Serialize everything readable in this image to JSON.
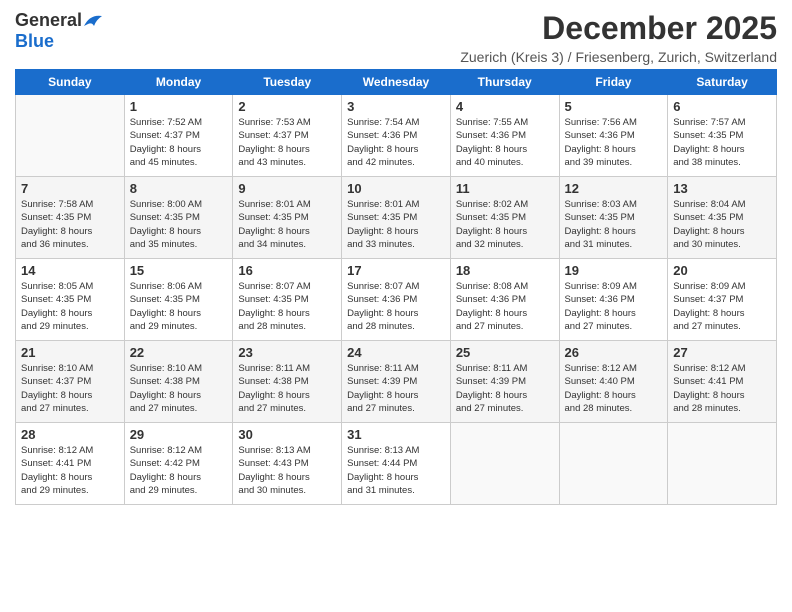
{
  "logo": {
    "general": "General",
    "blue": "Blue"
  },
  "header": {
    "title": "December 2025",
    "subtitle": "Zuerich (Kreis 3) / Friesenberg, Zurich, Switzerland"
  },
  "calendar": {
    "days": [
      "Sunday",
      "Monday",
      "Tuesday",
      "Wednesday",
      "Thursday",
      "Friday",
      "Saturday"
    ],
    "weeks": [
      [
        {
          "day": "",
          "info": ""
        },
        {
          "day": "1",
          "info": "Sunrise: 7:52 AM\nSunset: 4:37 PM\nDaylight: 8 hours\nand 45 minutes."
        },
        {
          "day": "2",
          "info": "Sunrise: 7:53 AM\nSunset: 4:37 PM\nDaylight: 8 hours\nand 43 minutes."
        },
        {
          "day": "3",
          "info": "Sunrise: 7:54 AM\nSunset: 4:36 PM\nDaylight: 8 hours\nand 42 minutes."
        },
        {
          "day": "4",
          "info": "Sunrise: 7:55 AM\nSunset: 4:36 PM\nDaylight: 8 hours\nand 40 minutes."
        },
        {
          "day": "5",
          "info": "Sunrise: 7:56 AM\nSunset: 4:36 PM\nDaylight: 8 hours\nand 39 minutes."
        },
        {
          "day": "6",
          "info": "Sunrise: 7:57 AM\nSunset: 4:35 PM\nDaylight: 8 hours\nand 38 minutes."
        }
      ],
      [
        {
          "day": "7",
          "info": "Sunrise: 7:58 AM\nSunset: 4:35 PM\nDaylight: 8 hours\nand 36 minutes."
        },
        {
          "day": "8",
          "info": "Sunrise: 8:00 AM\nSunset: 4:35 PM\nDaylight: 8 hours\nand 35 minutes."
        },
        {
          "day": "9",
          "info": "Sunrise: 8:01 AM\nSunset: 4:35 PM\nDaylight: 8 hours\nand 34 minutes."
        },
        {
          "day": "10",
          "info": "Sunrise: 8:01 AM\nSunset: 4:35 PM\nDaylight: 8 hours\nand 33 minutes."
        },
        {
          "day": "11",
          "info": "Sunrise: 8:02 AM\nSunset: 4:35 PM\nDaylight: 8 hours\nand 32 minutes."
        },
        {
          "day": "12",
          "info": "Sunrise: 8:03 AM\nSunset: 4:35 PM\nDaylight: 8 hours\nand 31 minutes."
        },
        {
          "day": "13",
          "info": "Sunrise: 8:04 AM\nSunset: 4:35 PM\nDaylight: 8 hours\nand 30 minutes."
        }
      ],
      [
        {
          "day": "14",
          "info": "Sunrise: 8:05 AM\nSunset: 4:35 PM\nDaylight: 8 hours\nand 29 minutes."
        },
        {
          "day": "15",
          "info": "Sunrise: 8:06 AM\nSunset: 4:35 PM\nDaylight: 8 hours\nand 29 minutes."
        },
        {
          "day": "16",
          "info": "Sunrise: 8:07 AM\nSunset: 4:35 PM\nDaylight: 8 hours\nand 28 minutes."
        },
        {
          "day": "17",
          "info": "Sunrise: 8:07 AM\nSunset: 4:36 PM\nDaylight: 8 hours\nand 28 minutes."
        },
        {
          "day": "18",
          "info": "Sunrise: 8:08 AM\nSunset: 4:36 PM\nDaylight: 8 hours\nand 27 minutes."
        },
        {
          "day": "19",
          "info": "Sunrise: 8:09 AM\nSunset: 4:36 PM\nDaylight: 8 hours\nand 27 minutes."
        },
        {
          "day": "20",
          "info": "Sunrise: 8:09 AM\nSunset: 4:37 PM\nDaylight: 8 hours\nand 27 minutes."
        }
      ],
      [
        {
          "day": "21",
          "info": "Sunrise: 8:10 AM\nSunset: 4:37 PM\nDaylight: 8 hours\nand 27 minutes."
        },
        {
          "day": "22",
          "info": "Sunrise: 8:10 AM\nSunset: 4:38 PM\nDaylight: 8 hours\nand 27 minutes."
        },
        {
          "day": "23",
          "info": "Sunrise: 8:11 AM\nSunset: 4:38 PM\nDaylight: 8 hours\nand 27 minutes."
        },
        {
          "day": "24",
          "info": "Sunrise: 8:11 AM\nSunset: 4:39 PM\nDaylight: 8 hours\nand 27 minutes."
        },
        {
          "day": "25",
          "info": "Sunrise: 8:11 AM\nSunset: 4:39 PM\nDaylight: 8 hours\nand 27 minutes."
        },
        {
          "day": "26",
          "info": "Sunrise: 8:12 AM\nSunset: 4:40 PM\nDaylight: 8 hours\nand 28 minutes."
        },
        {
          "day": "27",
          "info": "Sunrise: 8:12 AM\nSunset: 4:41 PM\nDaylight: 8 hours\nand 28 minutes."
        }
      ],
      [
        {
          "day": "28",
          "info": "Sunrise: 8:12 AM\nSunset: 4:41 PM\nDaylight: 8 hours\nand 29 minutes."
        },
        {
          "day": "29",
          "info": "Sunrise: 8:12 AM\nSunset: 4:42 PM\nDaylight: 8 hours\nand 29 minutes."
        },
        {
          "day": "30",
          "info": "Sunrise: 8:13 AM\nSunset: 4:43 PM\nDaylight: 8 hours\nand 30 minutes."
        },
        {
          "day": "31",
          "info": "Sunrise: 8:13 AM\nSunset: 4:44 PM\nDaylight: 8 hours\nand 31 minutes."
        },
        {
          "day": "",
          "info": ""
        },
        {
          "day": "",
          "info": ""
        },
        {
          "day": "",
          "info": ""
        }
      ]
    ]
  }
}
